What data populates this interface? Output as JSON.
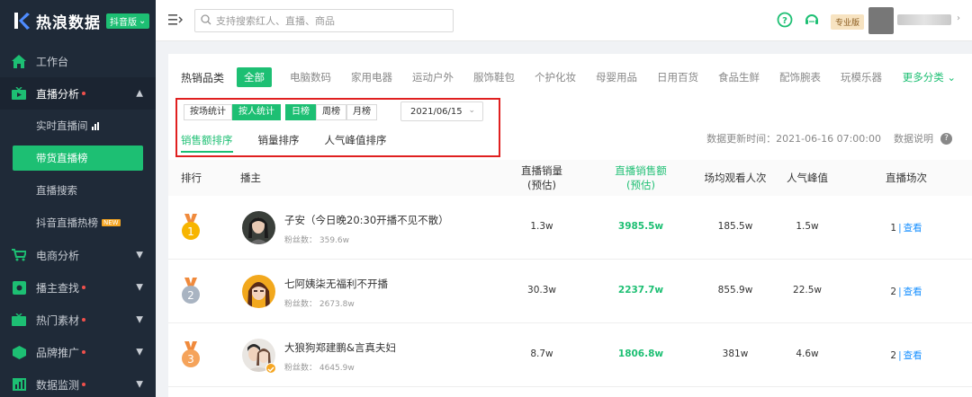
{
  "sidebar": {
    "logo_text": "热浪数据",
    "logo_badge": "抖音版",
    "items": [
      {
        "label": "工作台"
      },
      {
        "label": "直播分析"
      },
      {
        "label": "实时直播间"
      },
      {
        "label": "带货直播榜"
      },
      {
        "label": "直播搜索"
      },
      {
        "label": "抖音直播热榜",
        "badge": "NEW"
      },
      {
        "label": "电商分析"
      },
      {
        "label": "播主查找"
      },
      {
        "label": "热门素材"
      },
      {
        "label": "品牌推广"
      },
      {
        "label": "数据监测"
      }
    ]
  },
  "topbar": {
    "search_placeholder": "支持搜索红人、直播、商品",
    "pro_badge": "专业版"
  },
  "categories": {
    "label": "热销品类",
    "items": [
      "全部",
      "电脑数码",
      "家用电器",
      "运动户外",
      "服饰鞋包",
      "个护化妆",
      "母婴用品",
      "日用百货",
      "食品生鲜",
      "配饰腕表",
      "玩模乐器"
    ],
    "more": "更多分类"
  },
  "filters": {
    "stat_mode": [
      "按场统计",
      "按人统计"
    ],
    "period": [
      "日榜",
      "周榜",
      "月榜"
    ],
    "date": "2021/06/15"
  },
  "sort_tabs": [
    "销售额排序",
    "销量排序",
    "人气峰值排序"
  ],
  "update": {
    "text": "数据更新时间：2021-06-16 07:00:00",
    "explain": "数据说明"
  },
  "table": {
    "headers": {
      "rank": "排行",
      "anchor": "播主",
      "sales_qty_1": "直播销量",
      "sales_qty_2": "(预估)",
      "sales_amt_1": "直播销售额",
      "sales_amt_2": "(预估)",
      "avg_viewers": "场均观看人次",
      "peak": "人气峰值",
      "sessions": "直播场次"
    },
    "rows": [
      {
        "rank": "1",
        "name": "子安（今日晚20:30开播不见不散）",
        "fans": "粉丝数： 359.6w",
        "sales_qty": "1.3w",
        "sales_amt": "3985.5w",
        "avg_viewers": "185.5w",
        "peak": "1.5w",
        "sessions": "1",
        "view": "查看"
      },
      {
        "rank": "2",
        "name": "七阿姨柒无福利不开播",
        "fans": "粉丝数： 2673.8w",
        "sales_qty": "30.3w",
        "sales_amt": "2237.7w",
        "avg_viewers": "855.9w",
        "peak": "22.5w",
        "sessions": "2",
        "view": "查看"
      },
      {
        "rank": "3",
        "name": "大狼狗郑建鹏&言真夫妇",
        "fans": "粉丝数： 4645.9w",
        "sales_qty": "8.7w",
        "sales_amt": "1806.8w",
        "avg_viewers": "381w",
        "peak": "4.6w",
        "sessions": "2",
        "view": "查看"
      }
    ]
  },
  "colors": {
    "accent": "#1dbf73",
    "sidebar_bg": "#1f2a38",
    "highlight_box": "#e02020",
    "link": "#1890ff"
  }
}
